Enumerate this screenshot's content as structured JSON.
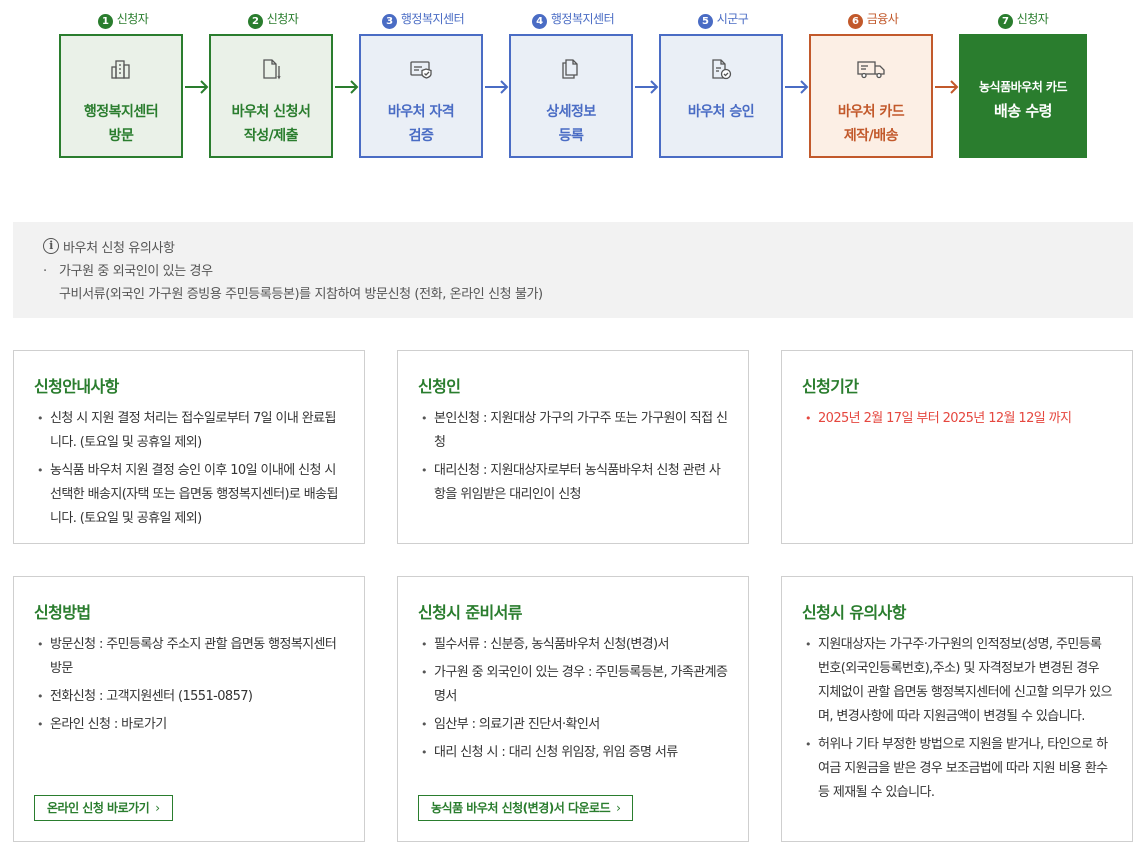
{
  "steps": [
    {
      "num": "1",
      "role": "신청자",
      "line1": "행정복지센터",
      "line2": "방문",
      "variant": "green",
      "icon": "building-icon"
    },
    {
      "num": "2",
      "role": "신청자",
      "line1": "바우처 신청서",
      "line2": "작성/제출",
      "variant": "green",
      "icon": "document-pen-icon"
    },
    {
      "num": "3",
      "role": "행정복지센터",
      "line1": "바우처 자격",
      "line2": "검증",
      "variant": "blue",
      "icon": "verify-card-icon"
    },
    {
      "num": "4",
      "role": "행정복지센터",
      "line1": "상세정보",
      "line2": "등록",
      "variant": "blue",
      "icon": "documents-icon"
    },
    {
      "num": "5",
      "role": "시군구",
      "line1": "바우처 승인",
      "line2": "",
      "variant": "blue",
      "icon": "approve-document-icon"
    },
    {
      "num": "6",
      "role": "금융사",
      "line1": "바우처 카드",
      "line2": "제작/배송",
      "variant": "orange",
      "icon": "delivery-truck-icon"
    },
    {
      "num": "7",
      "role": "신청자",
      "line1": "농식품바우처 카드",
      "line2": "배송 수령",
      "variant": "final",
      "icon": ""
    }
  ],
  "colors": {
    "green": "#2a7d2e",
    "blue": "#4a6cc4",
    "orange": "#c2592b",
    "red": "#e5473f"
  },
  "notice": {
    "title": "바우처 신청 유의사항",
    "line1": "가구원 중 외국인이 있는 경우",
    "line2": "구비서류(외국인 가구원 증빙용 주민등록등본)를 지참하여 방문신청 (전화, 온라인 신청 불가)"
  },
  "cards": {
    "guide": {
      "title": "신청안내사항",
      "items": [
        "신청 시 지원 결정 처리는 접수일로부터 7일 이내 완료됩니다. (토요일 및 공휴일 제외)",
        "농식품 바우처 지원 결정 승인 이후 10일 이내에 신청 시 선택한 배송지(자택 또는 읍면동 행정복지센터)로 배송됩니다. (토요일 및 공휴일 제외)"
      ]
    },
    "applicant": {
      "title": "신청인",
      "items": [
        "본인신청 : 지원대상 가구의 가구주 또는 가구원이 직접 신청",
        "대리신청 : 지원대상자로부터 농식품바우처 신청 관련 사항을 위임받은 대리인이 신청"
      ]
    },
    "period": {
      "title": "신청기간",
      "items": [
        "2025년 2월 17일 부터 2025년 12월 12일 까지"
      ]
    },
    "method": {
      "title": "신청방법",
      "items": [
        "방문신청 : 주민등록상 주소지 관할 읍면동 행정복지센터 방문",
        "전화신청 : 고객지원센터 (1551-0857)",
        "온라인 신청 : 바로가기"
      ],
      "button": "온라인 신청 바로가기",
      "chevron": "›"
    },
    "documents": {
      "title": "신청시 준비서류",
      "items": [
        "필수서류 : 신분증, 농식품바우처 신청(변경)서",
        "가구원 중 외국인이 있는 경우 : 주민등록등본, 가족관계증명서",
        "임산부 : 의료기관 진단서·확인서",
        "대리 신청 시 : 대리 신청 위임장, 위임 증명 서류"
      ],
      "button": "농식품 바우처 신청(변경)서 다운로드",
      "chevron": "›"
    },
    "cautions": {
      "title": "신청시 유의사항",
      "items": [
        "지원대상자는 가구주·가구원의 인적정보(성명, 주민등록번호(외국인등록번호),주소) 및 자격정보가 변경된 경우 지체없이 관할 읍면동 행정복지센터에 신고할 의무가 있으며, 변경사항에 따라 지원금액이 변경될 수 있습니다.",
        "허위나 기타 부정한 방법으로 지원을 받거나, 타인으로 하여금 지원금을 받은 경우 보조금법에 따라 지원 비용 환수 등 제재될 수 있습니다."
      ]
    }
  }
}
